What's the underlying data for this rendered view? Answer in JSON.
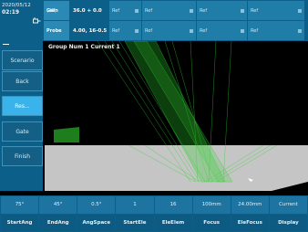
{
  "top": {
    "date": "2020/05/12",
    "time": "02:19",
    "icon": "probe-connector-icon",
    "row1": [
      {
        "text": "Gain",
        "sub": "(dB)"
      },
      {
        "text": "36.0 + 0.0"
      },
      {
        "text": "Ref"
      },
      {
        "text": "Ref"
      },
      {
        "text": "Ref"
      },
      {
        "text": "Ref"
      }
    ],
    "row2": [
      {
        "text": "Probe"
      },
      {
        "text": "4.00, 16-0.5"
      },
      {
        "text": "Ref"
      },
      {
        "text": "Ref"
      },
      {
        "text": "Ref"
      },
      {
        "text": "Ref"
      }
    ]
  },
  "sidebar": {
    "items": [
      {
        "label": "Scenario"
      },
      {
        "label": "Back"
      },
      {
        "label": "Res..."
      },
      {
        "label": "Gate"
      },
      {
        "label": "Finish"
      }
    ]
  },
  "main": {
    "group_label": "Group Num  1  Current 1"
  },
  "softkeys": [
    {
      "value": "75°",
      "label": "StartAng"
    },
    {
      "value": "45°",
      "label": "EndAng"
    },
    {
      "value": "0.5°",
      "label": "AngSpace"
    },
    {
      "value": "1",
      "label": "StartEle"
    },
    {
      "value": "16",
      "label": "EleElem"
    },
    {
      "value": "100mm",
      "label": "Focus"
    },
    {
      "value": "24.00mm",
      "label": "EleFocus"
    },
    {
      "value": "Current",
      "label": "Display"
    }
  ],
  "colors": {
    "frame": "#0c5f88",
    "cell": "#1f7da8",
    "active": "#39b3ea",
    "beam": "#2fd12f",
    "part": "#c5c5c5",
    "wedge": "#1e7e1e"
  }
}
